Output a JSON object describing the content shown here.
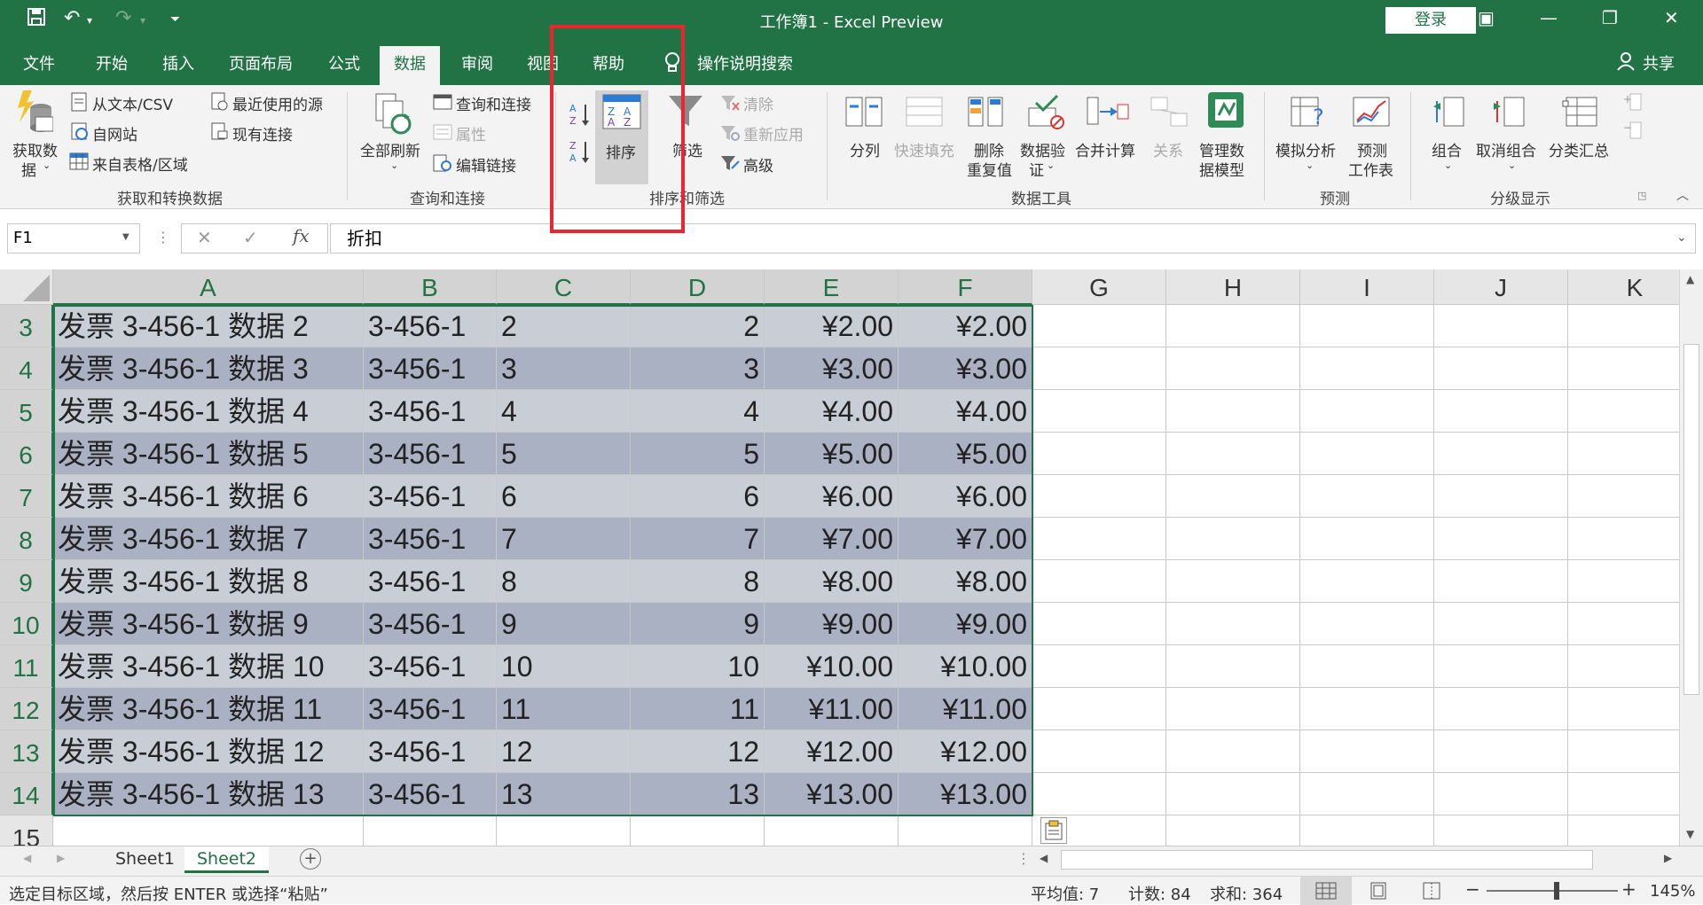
{
  "titlebar": {
    "title": "工作簿1  -  Excel Preview",
    "login_label": "登录",
    "qat_icons": [
      "save-icon",
      "undo-icon",
      "redo-icon",
      "customize-icon"
    ]
  },
  "tabs": [
    {
      "label": "文件"
    },
    {
      "label": "开始"
    },
    {
      "label": "插入"
    },
    {
      "label": "页面布局"
    },
    {
      "label": "公式"
    },
    {
      "label": "数据"
    },
    {
      "label": "审阅"
    },
    {
      "label": "视图"
    },
    {
      "label": "帮助"
    }
  ],
  "tell_me": "操作说明搜索",
  "share": "共享",
  "ribbon": {
    "get_data": "获取数",
    "get_data2": "据",
    "from_text": "从文本/CSV",
    "from_web": "自网站",
    "from_table": "来自表格/区域",
    "recent_sources": "最近使用的源",
    "existing_conn": "现有连接",
    "group_get": "获取和转换数据",
    "refresh_all": "全部刷新",
    "queries_conn": "查询和连接",
    "properties": "属性",
    "edit_links": "编辑链接",
    "group_queries": "查询和连接",
    "sort": "排序",
    "filter": "筛选",
    "clear": "清除",
    "reapply": "重新应用",
    "advanced": "高级",
    "group_sort": "排序和筛选",
    "text_to_cols": "分列",
    "flash_fill": "快速填充",
    "remove_dup1": "删除",
    "remove_dup2": "重复值",
    "validation1": "数据验",
    "validation2": "证",
    "consolidate": "合并计算",
    "relationships": "关系",
    "manage_model1": "管理数",
    "manage_model2": "据模型",
    "group_tools": "数据工具",
    "whatif": "模拟分析",
    "forecast1": "预测",
    "forecast2": "工作表",
    "group_forecast": "预测",
    "group_btn": "组合",
    "ungroup": "取消组合",
    "subtotal": "分类汇总",
    "group_outline": "分级显示"
  },
  "formula_bar": {
    "name_box": "F1",
    "content": "折扣"
  },
  "columns": [
    "A",
    "B",
    "C",
    "D",
    "E",
    "F",
    "G",
    "H",
    "I",
    "J",
    "K"
  ],
  "rows": [
    {
      "n": "3",
      "a": "发票 3-456-1 数据 2",
      "b": "3-456-1",
      "c": "2",
      "d": "2",
      "e": "¥2.00",
      "f": "¥2.00"
    },
    {
      "n": "4",
      "a": "发票 3-456-1 数据 3",
      "b": "3-456-1",
      "c": "3",
      "d": "3",
      "e": "¥3.00",
      "f": "¥3.00"
    },
    {
      "n": "5",
      "a": "发票 3-456-1 数据 4",
      "b": "3-456-1",
      "c": "4",
      "d": "4",
      "e": "¥4.00",
      "f": "¥4.00"
    },
    {
      "n": "6",
      "a": "发票 3-456-1 数据 5",
      "b": "3-456-1",
      "c": "5",
      "d": "5",
      "e": "¥5.00",
      "f": "¥5.00"
    },
    {
      "n": "7",
      "a": "发票 3-456-1 数据 6",
      "b": "3-456-1",
      "c": "6",
      "d": "6",
      "e": "¥6.00",
      "f": "¥6.00"
    },
    {
      "n": "8",
      "a": "发票 3-456-1 数据 7",
      "b": "3-456-1",
      "c": "7",
      "d": "7",
      "e": "¥7.00",
      "f": "¥7.00"
    },
    {
      "n": "9",
      "a": "发票 3-456-1 数据 8",
      "b": "3-456-1",
      "c": "8",
      "d": "8",
      "e": "¥8.00",
      "f": "¥8.00"
    },
    {
      "n": "10",
      "a": "发票 3-456-1 数据 9",
      "b": "3-456-1",
      "c": "9",
      "d": "9",
      "e": "¥9.00",
      "f": "¥9.00"
    },
    {
      "n": "11",
      "a": "发票 3-456-1 数据 10",
      "b": "3-456-1",
      "c": "10",
      "d": "10",
      "e": "¥10.00",
      "f": "¥10.00"
    },
    {
      "n": "12",
      "a": "发票 3-456-1 数据 11",
      "b": "3-456-1",
      "c": "11",
      "d": "11",
      "e": "¥11.00",
      "f": "¥11.00"
    },
    {
      "n": "13",
      "a": "发票 3-456-1 数据 12",
      "b": "3-456-1",
      "c": "12",
      "d": "12",
      "e": "¥12.00",
      "f": "¥12.00"
    },
    {
      "n": "14",
      "a": "发票 3-456-1 数据 13",
      "b": "3-456-1",
      "c": "13",
      "d": "13",
      "e": "¥13.00",
      "f": "¥13.00"
    },
    {
      "n": "15",
      "a": "",
      "b": "",
      "c": "",
      "d": "",
      "e": "",
      "f": ""
    }
  ],
  "sheets": [
    "Sheet1",
    "Sheet2"
  ],
  "status": {
    "message": "选定目标区域，然后按 ENTER 或选择“粘贴”",
    "average": "平均值: 7",
    "count": "计数: 84",
    "sum": "求和: 364",
    "zoom": "145%"
  },
  "colors": {
    "excel_green": "#217346",
    "highlight": "#e8282e"
  }
}
